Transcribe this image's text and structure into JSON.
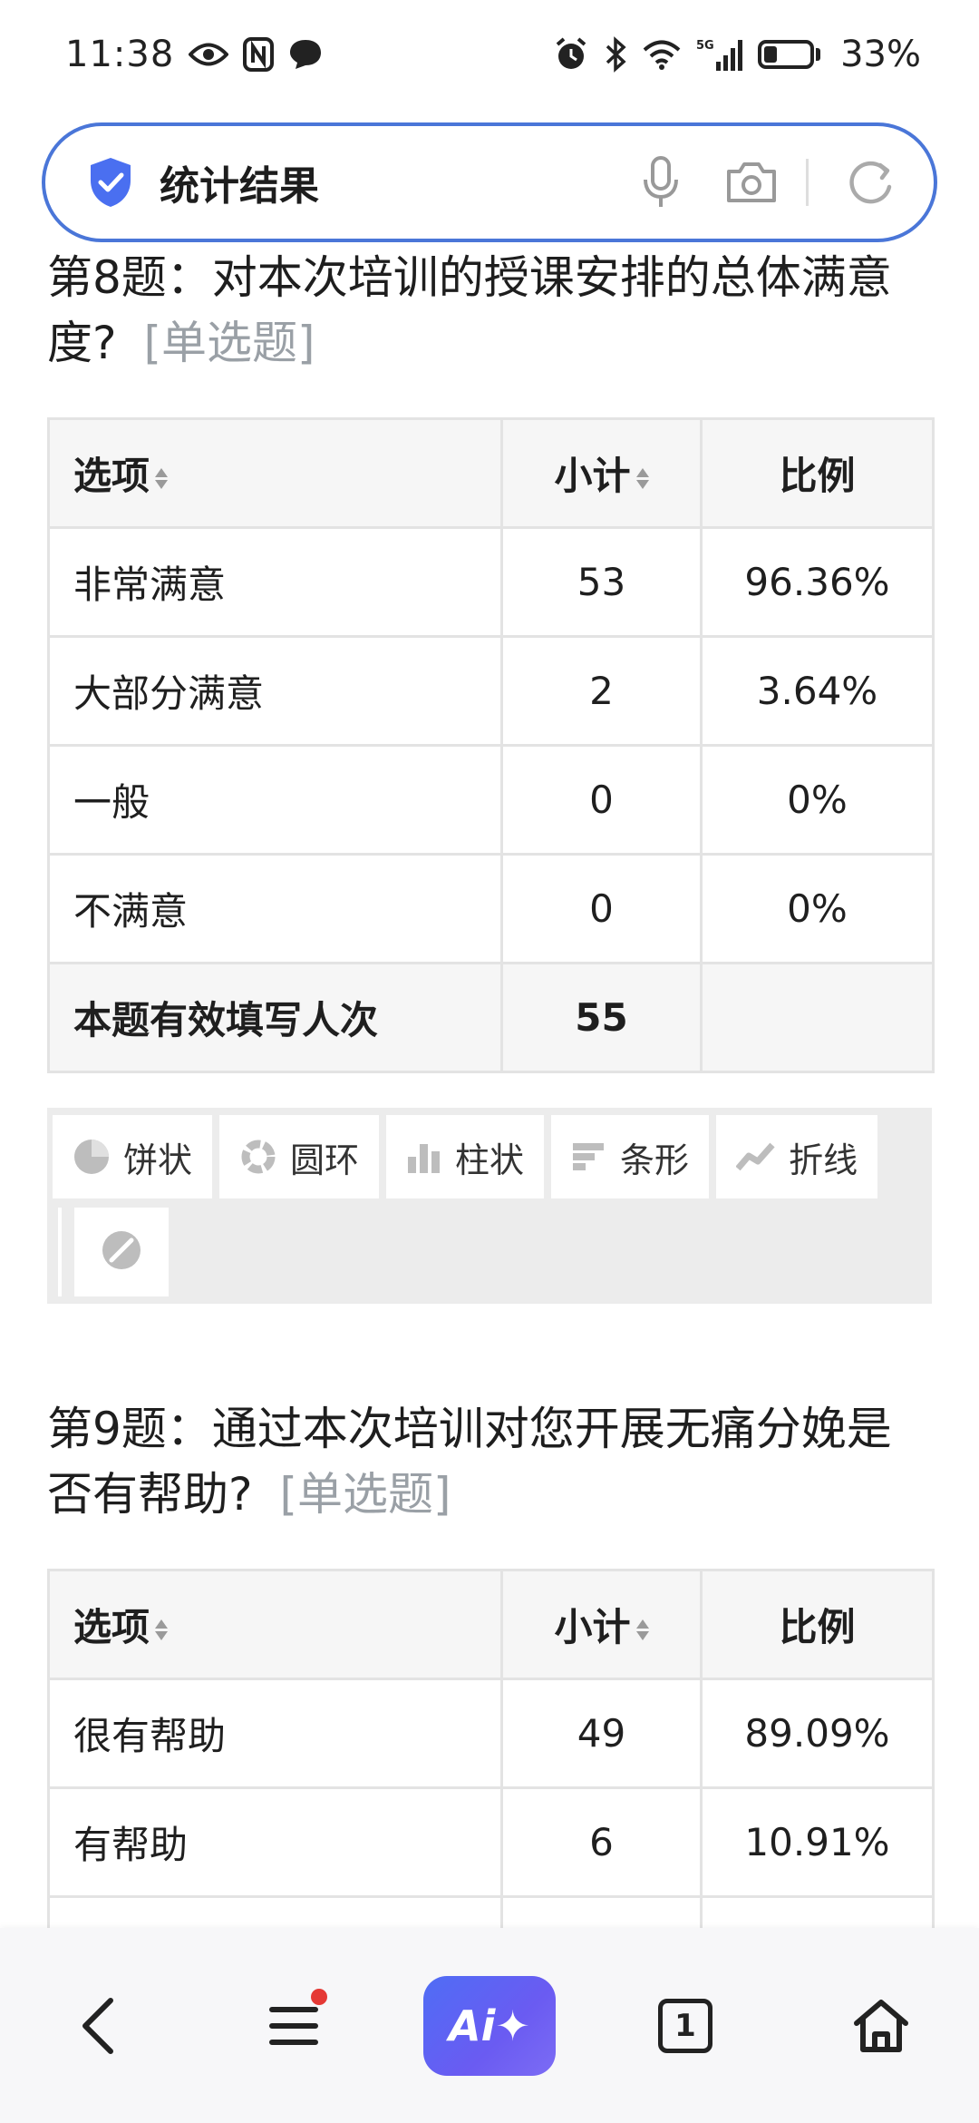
{
  "status_bar": {
    "time": "11:38",
    "battery_text": "33%",
    "battery_level": 0.33,
    "network_label": "5G",
    "left_icons": [
      "eye-icon",
      "nfc-icon",
      "chat-bubble-icon"
    ],
    "right_icons": [
      "alarm-icon",
      "bluetooth-icon",
      "wifi-icon",
      "signal-icon",
      "battery-icon"
    ]
  },
  "address_bar": {
    "title": "统计结果",
    "accent_color": "#4a76d8",
    "icons": [
      "shield-check-icon",
      "microphone-icon",
      "camera-icon",
      "refresh-icon"
    ]
  },
  "questions": [
    {
      "title": "第8题：对本次培训的授课安排的总体满意度?",
      "type_label": "[单选题]",
      "headers": {
        "option": "选项",
        "count": "小计",
        "ratio": "比例"
      },
      "rows": [
        {
          "option": "非常满意",
          "count": "53",
          "ratio": "96.36%"
        },
        {
          "option": "大部分满意",
          "count": "2",
          "ratio": "3.64%"
        },
        {
          "option": "一般",
          "count": "0",
          "ratio": "0%"
        },
        {
          "option": "不满意",
          "count": "0",
          "ratio": "0%"
        }
      ],
      "total": {
        "label": "本题有效填写人次",
        "count": "55",
        "ratio": ""
      },
      "chart_types": [
        {
          "label": "饼状",
          "icon": "pie-chart-icon"
        },
        {
          "label": "圆环",
          "icon": "donut-chart-icon"
        },
        {
          "label": "柱状",
          "icon": "bar-chart-icon"
        },
        {
          "label": "条形",
          "icon": "horizontal-bar-icon"
        },
        {
          "label": "折线",
          "icon": "line-chart-icon"
        }
      ],
      "hide_chart_icon": "hide-chart-icon"
    },
    {
      "title": "第9题：通过本次培训对您开展无痛分娩是否有帮助?",
      "type_label": "[单选题]",
      "headers": {
        "option": "选项",
        "count": "小计",
        "ratio": "比例"
      },
      "rows": [
        {
          "option": "很有帮助",
          "count": "49",
          "ratio": "89.09%"
        },
        {
          "option": "有帮助",
          "count": "6",
          "ratio": "10.91%"
        }
      ]
    }
  ],
  "bottom_nav": {
    "ai_label": "Ai✦",
    "tab_count": "1",
    "items": [
      "back-icon",
      "menu-icon",
      "ai-assistant-button",
      "tabs-icon",
      "home-icon"
    ]
  }
}
